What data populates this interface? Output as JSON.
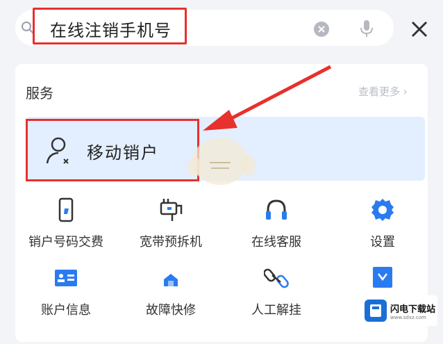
{
  "search": {
    "query": "在线注销手机号"
  },
  "services_section": {
    "title": "服务",
    "view_more": "查看更多 ›"
  },
  "result": {
    "label": "移动销户"
  },
  "services": [
    {
      "label": "销户号码交费",
      "icon": "phone-icon"
    },
    {
      "label": "宽带预拆机",
      "icon": "router-icon"
    },
    {
      "label": "在线客服",
      "icon": "headset-icon"
    },
    {
      "label": "设置",
      "icon": "gear-icon"
    },
    {
      "label": "账户信息",
      "icon": "id-card-icon"
    },
    {
      "label": "故障快修",
      "icon": "repair-icon"
    },
    {
      "label": "人工解挂",
      "icon": "link-icon"
    },
    {
      "label": "",
      "icon": "card-icon"
    }
  ],
  "watermark": {
    "title": "闪电下载站",
    "sub": "www.sdxz.com"
  },
  "colors": {
    "accent": "#2b7bf0",
    "highlight": "#e8302c",
    "result_bg": "#e3efff"
  }
}
